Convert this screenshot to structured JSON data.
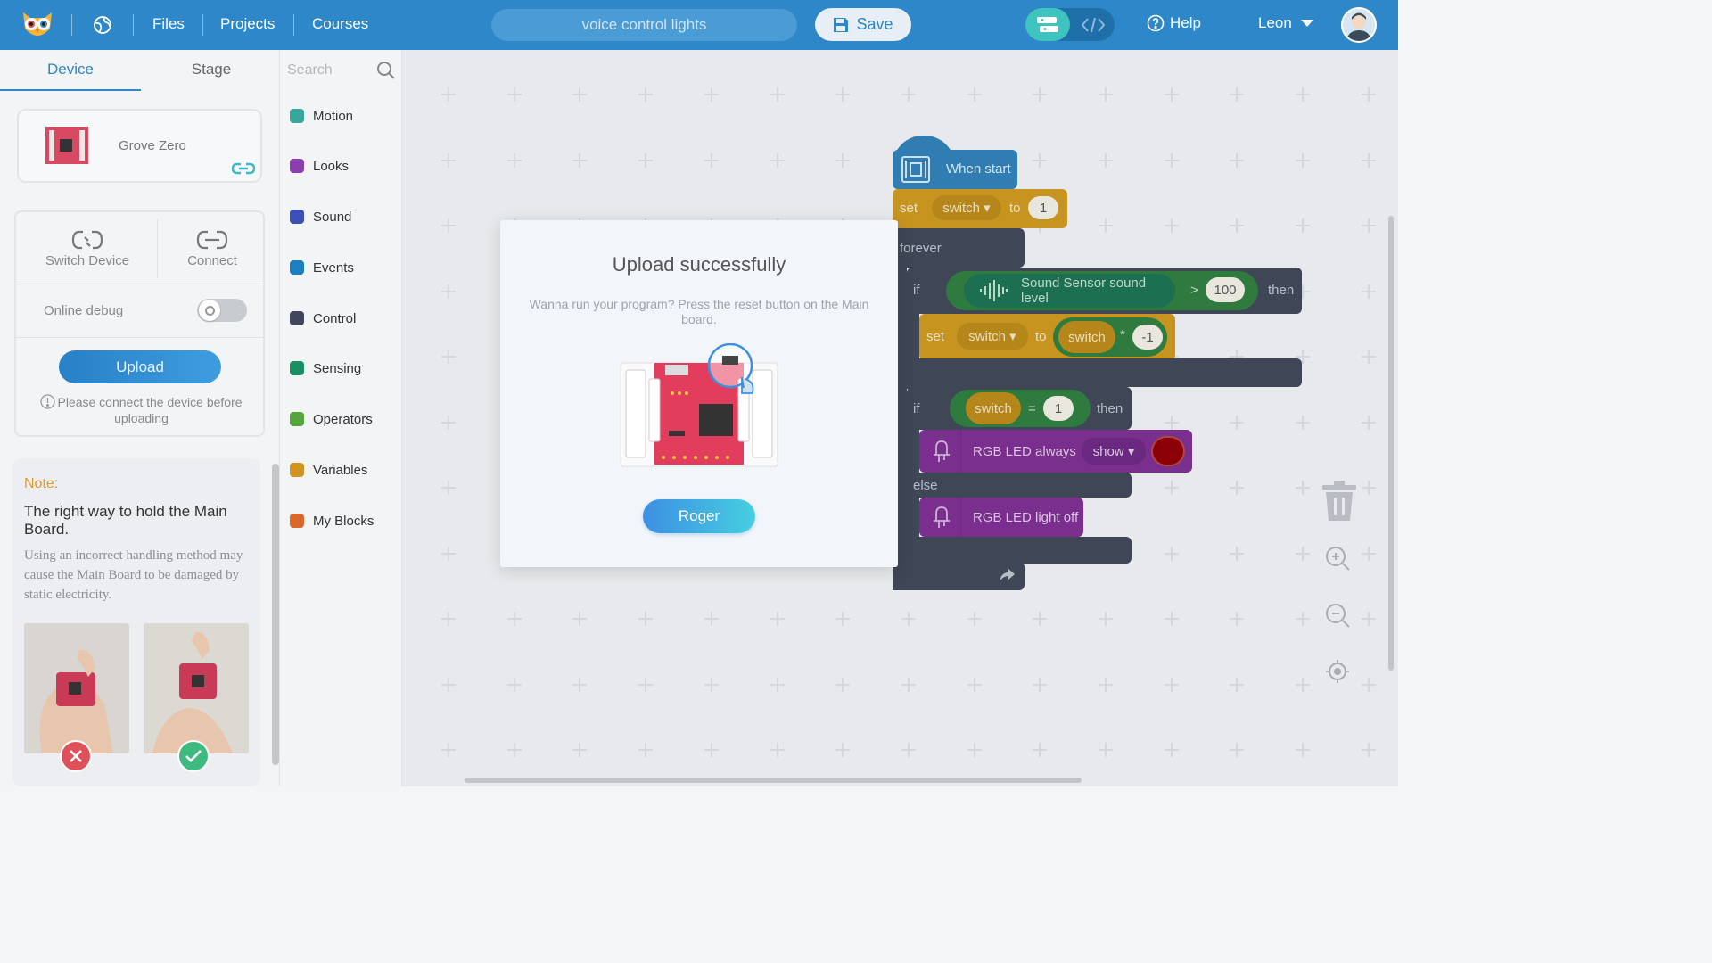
{
  "topbar": {
    "nav": [
      "Files",
      "Projects",
      "Courses"
    ],
    "project_name": "voice control lights",
    "save_label": "Save",
    "help_label": "Help",
    "user_name": "Leon"
  },
  "left_panel": {
    "tabs": [
      "Device",
      "Stage"
    ],
    "device_name": "Grove Zero",
    "actions": [
      "Switch Device",
      "Connect"
    ],
    "debug_label": "Online debug",
    "debug_on": false,
    "upload_label": "Upload",
    "upload_hint": "Please connect the device before uploading",
    "note": {
      "title": "Note:",
      "heading": "The right way to hold the Main Board.",
      "body": "Using an incorrect handling method may cause the Main Board to be damaged by static electricity."
    }
  },
  "categories": {
    "search_placeholder": "Search",
    "items": [
      {
        "label": "Motion",
        "color": "#3aa59b"
      },
      {
        "label": "Looks",
        "color": "#8a3fb0"
      },
      {
        "label": "Sound",
        "color": "#3c4fb8"
      },
      {
        "label": "Events",
        "color": "#1e7fc0"
      },
      {
        "label": "Control",
        "color": "#41475a"
      },
      {
        "label": "Sensing",
        "color": "#1c8f62"
      },
      {
        "label": "Operators",
        "color": "#53a53c"
      },
      {
        "label": "Variables",
        "color": "#cf9421"
      },
      {
        "label": "My Blocks",
        "color": "#d9662b"
      }
    ]
  },
  "blocks": {
    "when_start": "When start",
    "set": "set",
    "to": "to",
    "switch": "switch",
    "value_one": "1",
    "forever": "forever",
    "if": "if",
    "then": "then",
    "sound_level": "Sound Sensor sound level",
    "gt": ">",
    "threshold": "100",
    "multiply": "*",
    "neg_one": "-1",
    "eq": "=",
    "rgb_always": "RGB LED always",
    "show": "show",
    "else": "else",
    "rgb_off": "RGB LED light off"
  },
  "modal": {
    "title": "Upload successfully",
    "text": "Wanna run your program? Press the reset button on the Main board.",
    "button": "Roger"
  }
}
